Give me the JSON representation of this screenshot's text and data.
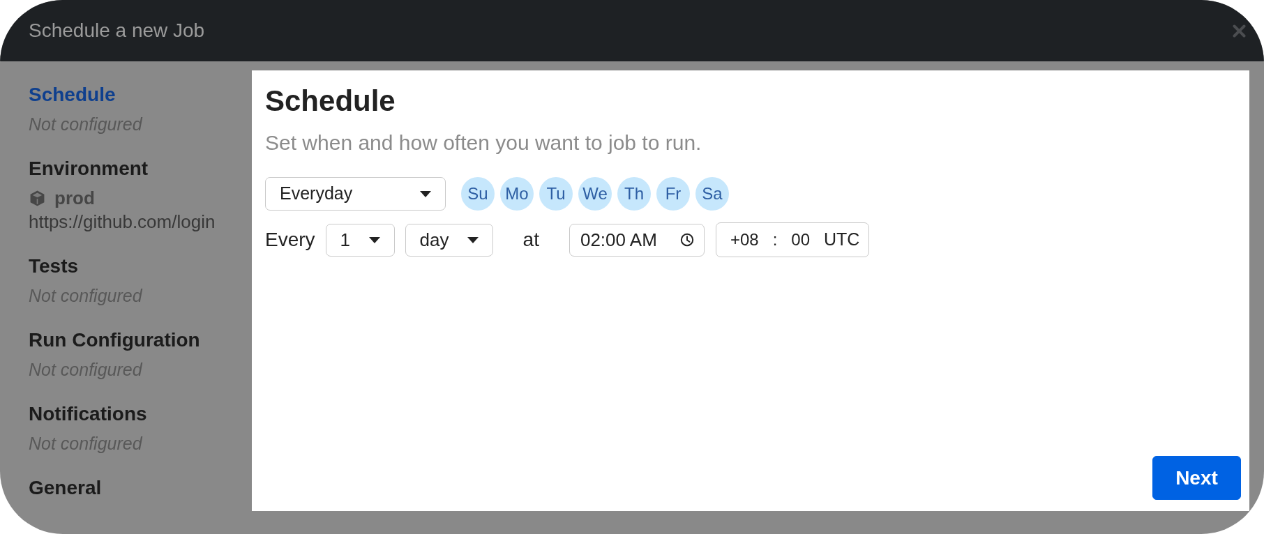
{
  "window": {
    "title": "Schedule a new Job"
  },
  "steps": [
    {
      "title": "Schedule",
      "selected": true,
      "status": "Not configured"
    },
    {
      "title": "Environment",
      "selected": false,
      "environment": {
        "name": "prod",
        "url": "https://github.com/login"
      }
    },
    {
      "title": "Tests",
      "selected": false,
      "status": "Not configured"
    },
    {
      "title": "Run Configuration",
      "selected": false,
      "status": "Not configured"
    },
    {
      "title": "Notifications",
      "selected": false,
      "status": "Not configured"
    },
    {
      "title": "General",
      "selected": false
    }
  ],
  "panel": {
    "heading": "Schedule",
    "description": "Set when and how often you want to job to run.",
    "frequency": {
      "value": "Everyday"
    },
    "weekdays": [
      {
        "label": "Su",
        "selected": true
      },
      {
        "label": "Mo",
        "selected": true
      },
      {
        "label": "Tu",
        "selected": true
      },
      {
        "label": "We",
        "selected": true
      },
      {
        "label": "Th",
        "selected": true
      },
      {
        "label": "Fr",
        "selected": true
      },
      {
        "label": "Sa",
        "selected": true
      }
    ],
    "interval": {
      "label": "Every",
      "count": "1",
      "unit": "day"
    },
    "time": {
      "label": "at",
      "value": "02:00 AM"
    },
    "utc_offset": {
      "hours": "+08",
      "separator": ":",
      "minutes": "00",
      "suffix": "UTC"
    }
  },
  "actions": [
    {
      "label": "Next"
    }
  ]
}
